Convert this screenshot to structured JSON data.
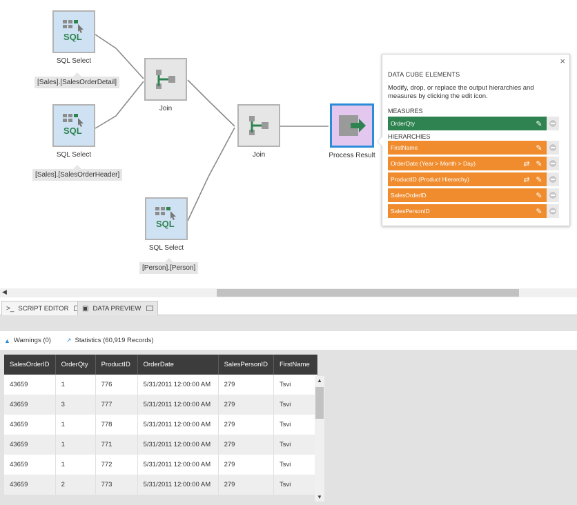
{
  "nodes": {
    "sql1": {
      "label": "SQL Select",
      "tag": "[Sales].[SalesOrderDetail]",
      "icon": "sql-select-icon"
    },
    "sql2": {
      "label": "SQL Select",
      "tag": "[Sales].[SalesOrderHeader]",
      "icon": "sql-select-icon"
    },
    "sql3": {
      "label": "SQL Select",
      "tag": "[Person].[Person]",
      "icon": "sql-select-icon"
    },
    "join1": {
      "label": "Join",
      "icon": "join-icon"
    },
    "join2": {
      "label": "Join",
      "icon": "join-icon"
    },
    "result": {
      "label": "Process Result",
      "icon": "process-result-icon"
    }
  },
  "cube_panel": {
    "title": "DATA CUBE ELEMENTS",
    "description": "Modify, drop, or replace the output hierarchies and measures by clicking the edit icon.",
    "measures_label": "MEASURES",
    "measures": [
      {
        "label": "OrderQty"
      }
    ],
    "hierarchies_label": "HIERARCHIES",
    "hierarchies": [
      {
        "label": "FirstName",
        "has_swap": false
      },
      {
        "label": "OrderDate (Year > Month > Day)",
        "has_swap": true
      },
      {
        "label": "ProductID (Product Hierarchy)",
        "has_swap": true
      },
      {
        "label": "SalesOrderID",
        "has_swap": false
      },
      {
        "label": "SalesPersonID",
        "has_swap": false
      }
    ],
    "close": "×",
    "colors": {
      "measure": "#2e8350",
      "hierarchy": "#f08c2e"
    }
  },
  "tabs": [
    {
      "label": "SCRIPT EDITOR",
      "icon": "script-icon",
      "active": false
    },
    {
      "label": "DATA PREVIEW",
      "icon": "preview-icon",
      "active": true
    }
  ],
  "status": {
    "warnings": "Warnings (0)",
    "statistics": "Statistics (60,919 Records)"
  },
  "table": {
    "columns": [
      "SalesOrderID",
      "OrderQty",
      "ProductID",
      "OrderDate",
      "SalesPersonID",
      "FirstName"
    ],
    "rows": [
      [
        "43659",
        "1",
        "776",
        "5/31/2011 12:00:00 AM",
        "279",
        "Tsvi"
      ],
      [
        "43659",
        "3",
        "777",
        "5/31/2011 12:00:00 AM",
        "279",
        "Tsvi"
      ],
      [
        "43659",
        "1",
        "778",
        "5/31/2011 12:00:00 AM",
        "279",
        "Tsvi"
      ],
      [
        "43659",
        "1",
        "771",
        "5/31/2011 12:00:00 AM",
        "279",
        "Tsvi"
      ],
      [
        "43659",
        "1",
        "772",
        "5/31/2011 12:00:00 AM",
        "279",
        "Tsvi"
      ],
      [
        "43659",
        "2",
        "773",
        "5/31/2011 12:00:00 AM",
        "279",
        "Tsvi"
      ]
    ]
  }
}
